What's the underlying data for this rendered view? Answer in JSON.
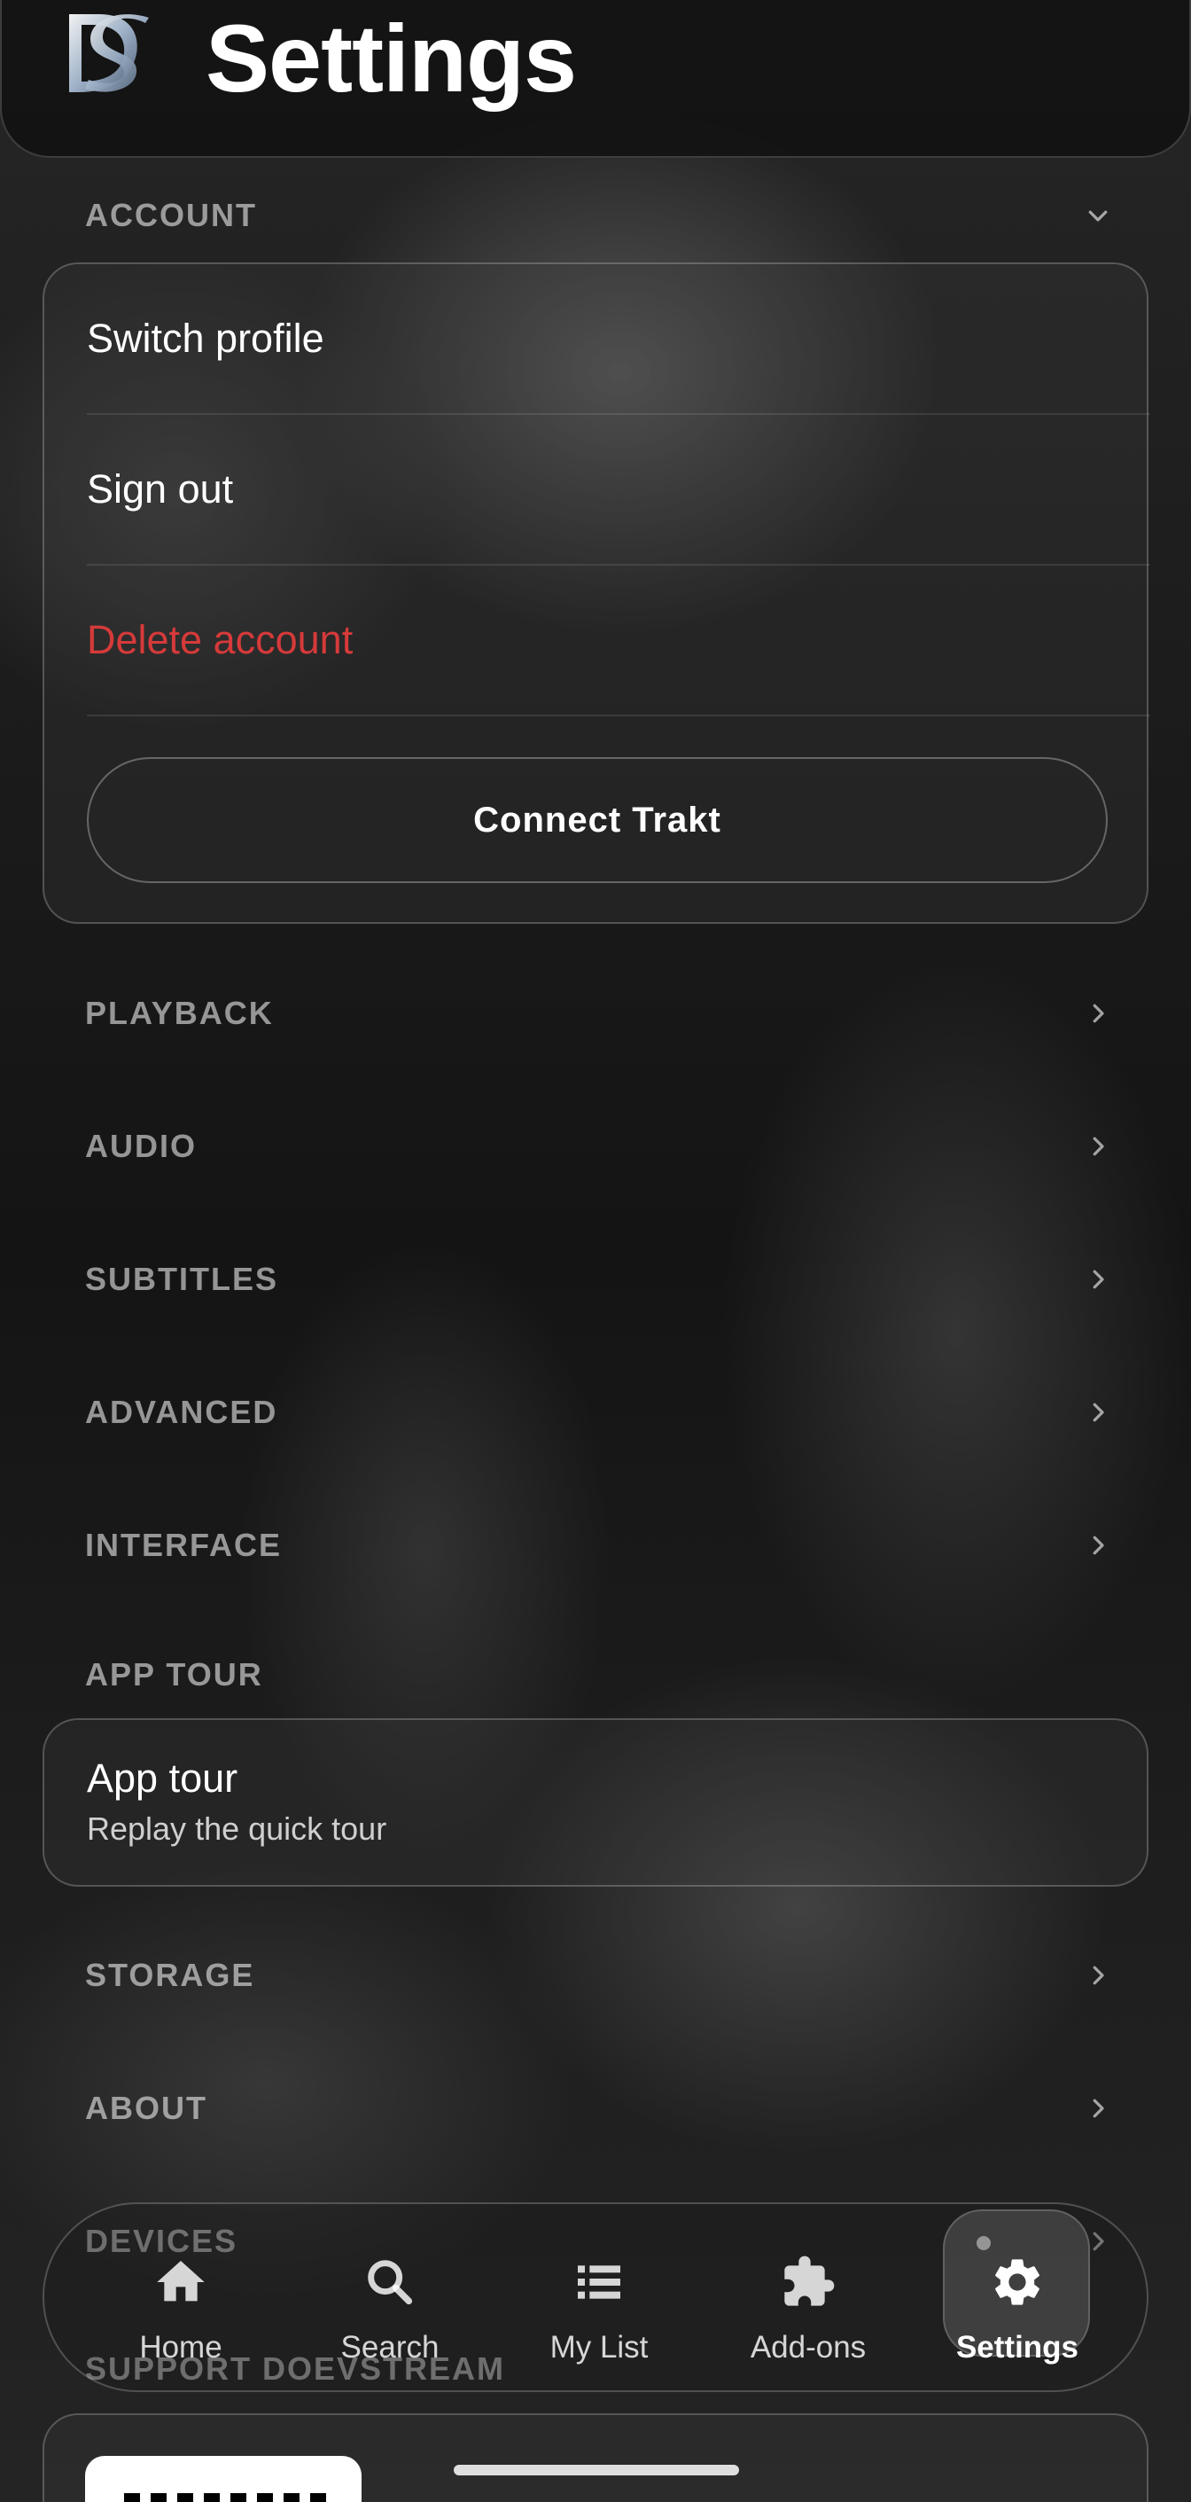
{
  "header": {
    "title": "Settings",
    "logo_text": "DS"
  },
  "sections": {
    "account": "ACCOUNT",
    "playback": "PLAYBACK",
    "audio": "AUDIO",
    "subtitles": "SUBTITLES",
    "advanced": "ADVANCED",
    "interface": "INTERFACE",
    "app_tour": "APP TOUR",
    "storage": "STORAGE",
    "about": "ABOUT",
    "devices": "DEVICES",
    "support": "SUPPORT DOEVSTREAM"
  },
  "account": {
    "switch_profile": "Switch profile",
    "sign_out": "Sign out",
    "delete_account": "Delete account",
    "connect_trakt": "Connect Trakt"
  },
  "app_tour": {
    "title": "App tour",
    "subtitle": "Replay the quick tour"
  },
  "nav": {
    "items": [
      {
        "label": "Home",
        "icon": "home-icon"
      },
      {
        "label": "Search",
        "icon": "search-icon"
      },
      {
        "label": "My List",
        "icon": "list-icon"
      },
      {
        "label": "Add-ons",
        "icon": "puzzle-icon"
      },
      {
        "label": "Settings",
        "icon": "gear-icon"
      }
    ],
    "active": "Settings"
  },
  "colors": {
    "danger": "#d63a3a",
    "section_label": "#8c8c8c",
    "text": "#ffffff"
  }
}
